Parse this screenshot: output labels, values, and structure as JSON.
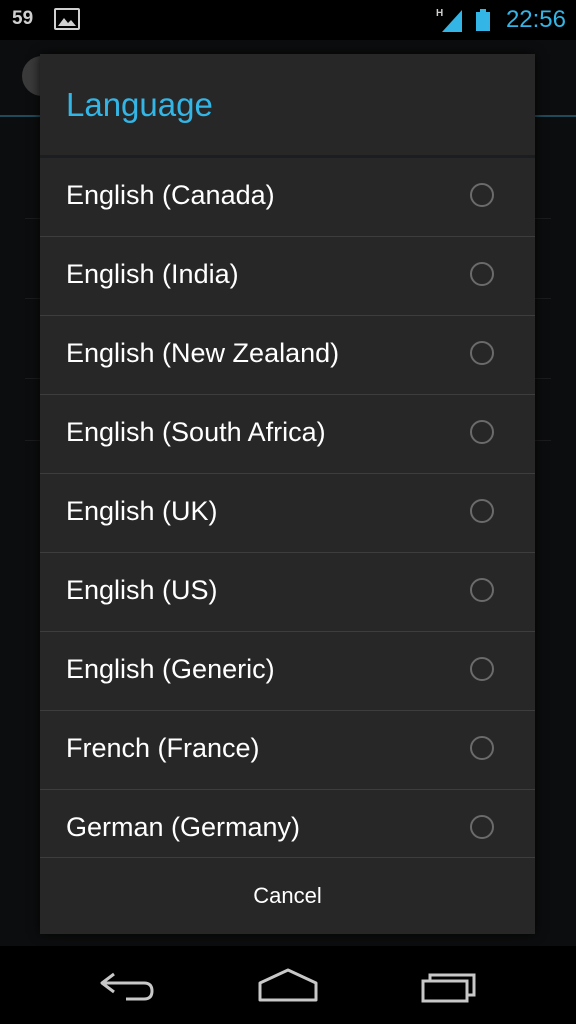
{
  "status_bar": {
    "left_text": "59",
    "time": "22:56",
    "network_type": "H",
    "icons": [
      "image-icon",
      "signal-icon",
      "battery-icon"
    ]
  },
  "dialog": {
    "title": "Language",
    "options": [
      {
        "label": "English (Canada)",
        "selected": false
      },
      {
        "label": "English (India)",
        "selected": false
      },
      {
        "label": "English (New Zealand)",
        "selected": false
      },
      {
        "label": "English (South Africa)",
        "selected": false
      },
      {
        "label": "English (UK)",
        "selected": false
      },
      {
        "label": "English (US)",
        "selected": false
      },
      {
        "label": "English (Generic)",
        "selected": false
      },
      {
        "label": "French (France)",
        "selected": false
      },
      {
        "label": "German (Germany)",
        "selected": false
      }
    ],
    "cancel_label": "Cancel"
  },
  "nav_bar": {
    "icons": [
      "back-icon",
      "home-icon",
      "recent-apps-icon"
    ]
  },
  "colors": {
    "accent": "#33b5e5",
    "dialog_bg": "#272727",
    "divider": "#3d3d3d"
  }
}
